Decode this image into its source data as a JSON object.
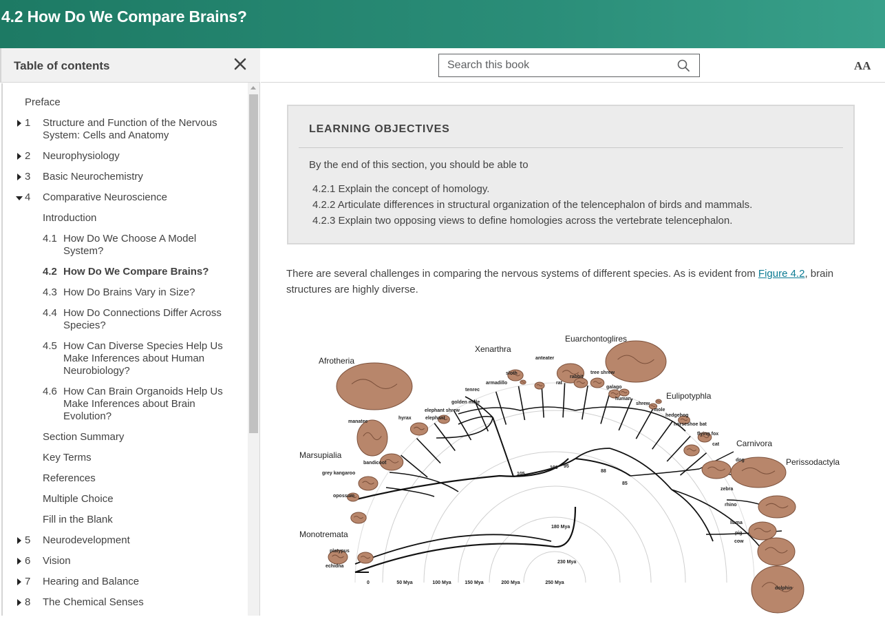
{
  "header": {
    "title": "4.2 How Do We Compare Brains?"
  },
  "sidebar": {
    "title": "Table of contents",
    "items": [
      {
        "num": "",
        "label": "Preface",
        "level": 0,
        "expander": "none"
      },
      {
        "num": "1",
        "label": "Structure and Function of the Nervous",
        "label2": "System: Cells and Anatomy",
        "level": 0,
        "expander": "right"
      },
      {
        "num": "2",
        "label": "Neurophysiology",
        "level": 0,
        "expander": "right"
      },
      {
        "num": "3",
        "label": "Basic Neurochemistry",
        "level": 0,
        "expander": "right"
      },
      {
        "num": "4",
        "label": "Comparative Neuroscience",
        "level": 0,
        "expander": "down"
      },
      {
        "num": "",
        "label": "Introduction",
        "level": 1
      },
      {
        "num": "4.1",
        "label": "How Do We Choose A Model",
        "label2": "System?",
        "level": 1
      },
      {
        "num": "4.2",
        "label": "How Do We Compare Brains?",
        "level": 1,
        "active": true
      },
      {
        "num": "4.3",
        "label": "How Do Brains Vary in Size?",
        "level": 1
      },
      {
        "num": "4.4",
        "label": "How Do Connections Differ Across",
        "label2": "Species?",
        "level": 1
      },
      {
        "num": "4.5",
        "label": "How Can Diverse Species Help Us",
        "label2": "Make Inferences about Human",
        "label3": "Neurobiology?",
        "level": 1
      },
      {
        "num": "4.6",
        "label": "How Can Brain Organoids Help Us",
        "label2": "Make Inferences about Brain",
        "label3": "Evolution?",
        "level": 1
      },
      {
        "num": "",
        "label": "Section Summary",
        "level": 1
      },
      {
        "num": "",
        "label": "Key Terms",
        "level": 1
      },
      {
        "num": "",
        "label": "References",
        "level": 1
      },
      {
        "num": "",
        "label": "Multiple Choice",
        "level": 1
      },
      {
        "num": "",
        "label": "Fill in the Blank",
        "level": 1
      },
      {
        "num": "5",
        "label": "Neurodevelopment",
        "level": 0,
        "expander": "right"
      },
      {
        "num": "6",
        "label": "Vision",
        "level": 0,
        "expander": "right"
      },
      {
        "num": "7",
        "label": "Hearing and Balance",
        "level": 0,
        "expander": "right"
      },
      {
        "num": "8",
        "label": "The Chemical Senses",
        "level": 0,
        "expander": "right"
      }
    ]
  },
  "toolbar": {
    "search_placeholder": "Search this book",
    "text_size_label": "AA"
  },
  "learning_objectives": {
    "title": "LEARNING OBJECTIVES",
    "intro": "By the end of this section, you should be able to",
    "items": [
      "4.2.1 Explain the concept of homology.",
      "4.2.2 Articulate differences in structural organization of the telencephalon of birds and mammals.",
      "4.2.3 Explain two opposing views to define homologies across the vertebrate telencephalon."
    ]
  },
  "body": {
    "para_before": "There are several challenges in comparing the nervous systems of different species. As is evident from ",
    "link": "Figure 4.2",
    "para_after": ", brain structures are highly diverse."
  },
  "figure": {
    "clades": [
      "Afrotheria",
      "Xenarthra",
      "Euarchontoglires",
      "Eulipotyphla",
      "Carnivora",
      "Perissodactyla",
      "Marsupialia",
      "Monotremata"
    ],
    "species": [
      "manatee",
      "hyrax",
      "elephant",
      "elephant shrew",
      "golden mole",
      "tenrec",
      "armadillo",
      "sloth",
      "anteater",
      "rat",
      "rabbit",
      "tree shrew",
      "galago",
      "human",
      "shrew",
      "mole",
      "hedgehog",
      "horseshoe bat",
      "flying fox",
      "cat",
      "dog",
      "zebra",
      "rhino",
      "llama",
      "pig",
      "cow",
      "dolphin",
      "bandicoot",
      "grey kangaroo",
      "opossum",
      "platypus",
      "echidna"
    ],
    "time_axis": [
      "0",
      "50 Mya",
      "100 Mya",
      "150 Mya",
      "200 Mya",
      "250 Mya"
    ],
    "node_labels": [
      "105",
      "100",
      "95",
      "88",
      "85",
      "180 Mya",
      "230 Mya"
    ],
    "colors": {
      "brain": "#b8866b",
      "brain_dark": "#7a4f3a",
      "tree": "#111111"
    }
  }
}
